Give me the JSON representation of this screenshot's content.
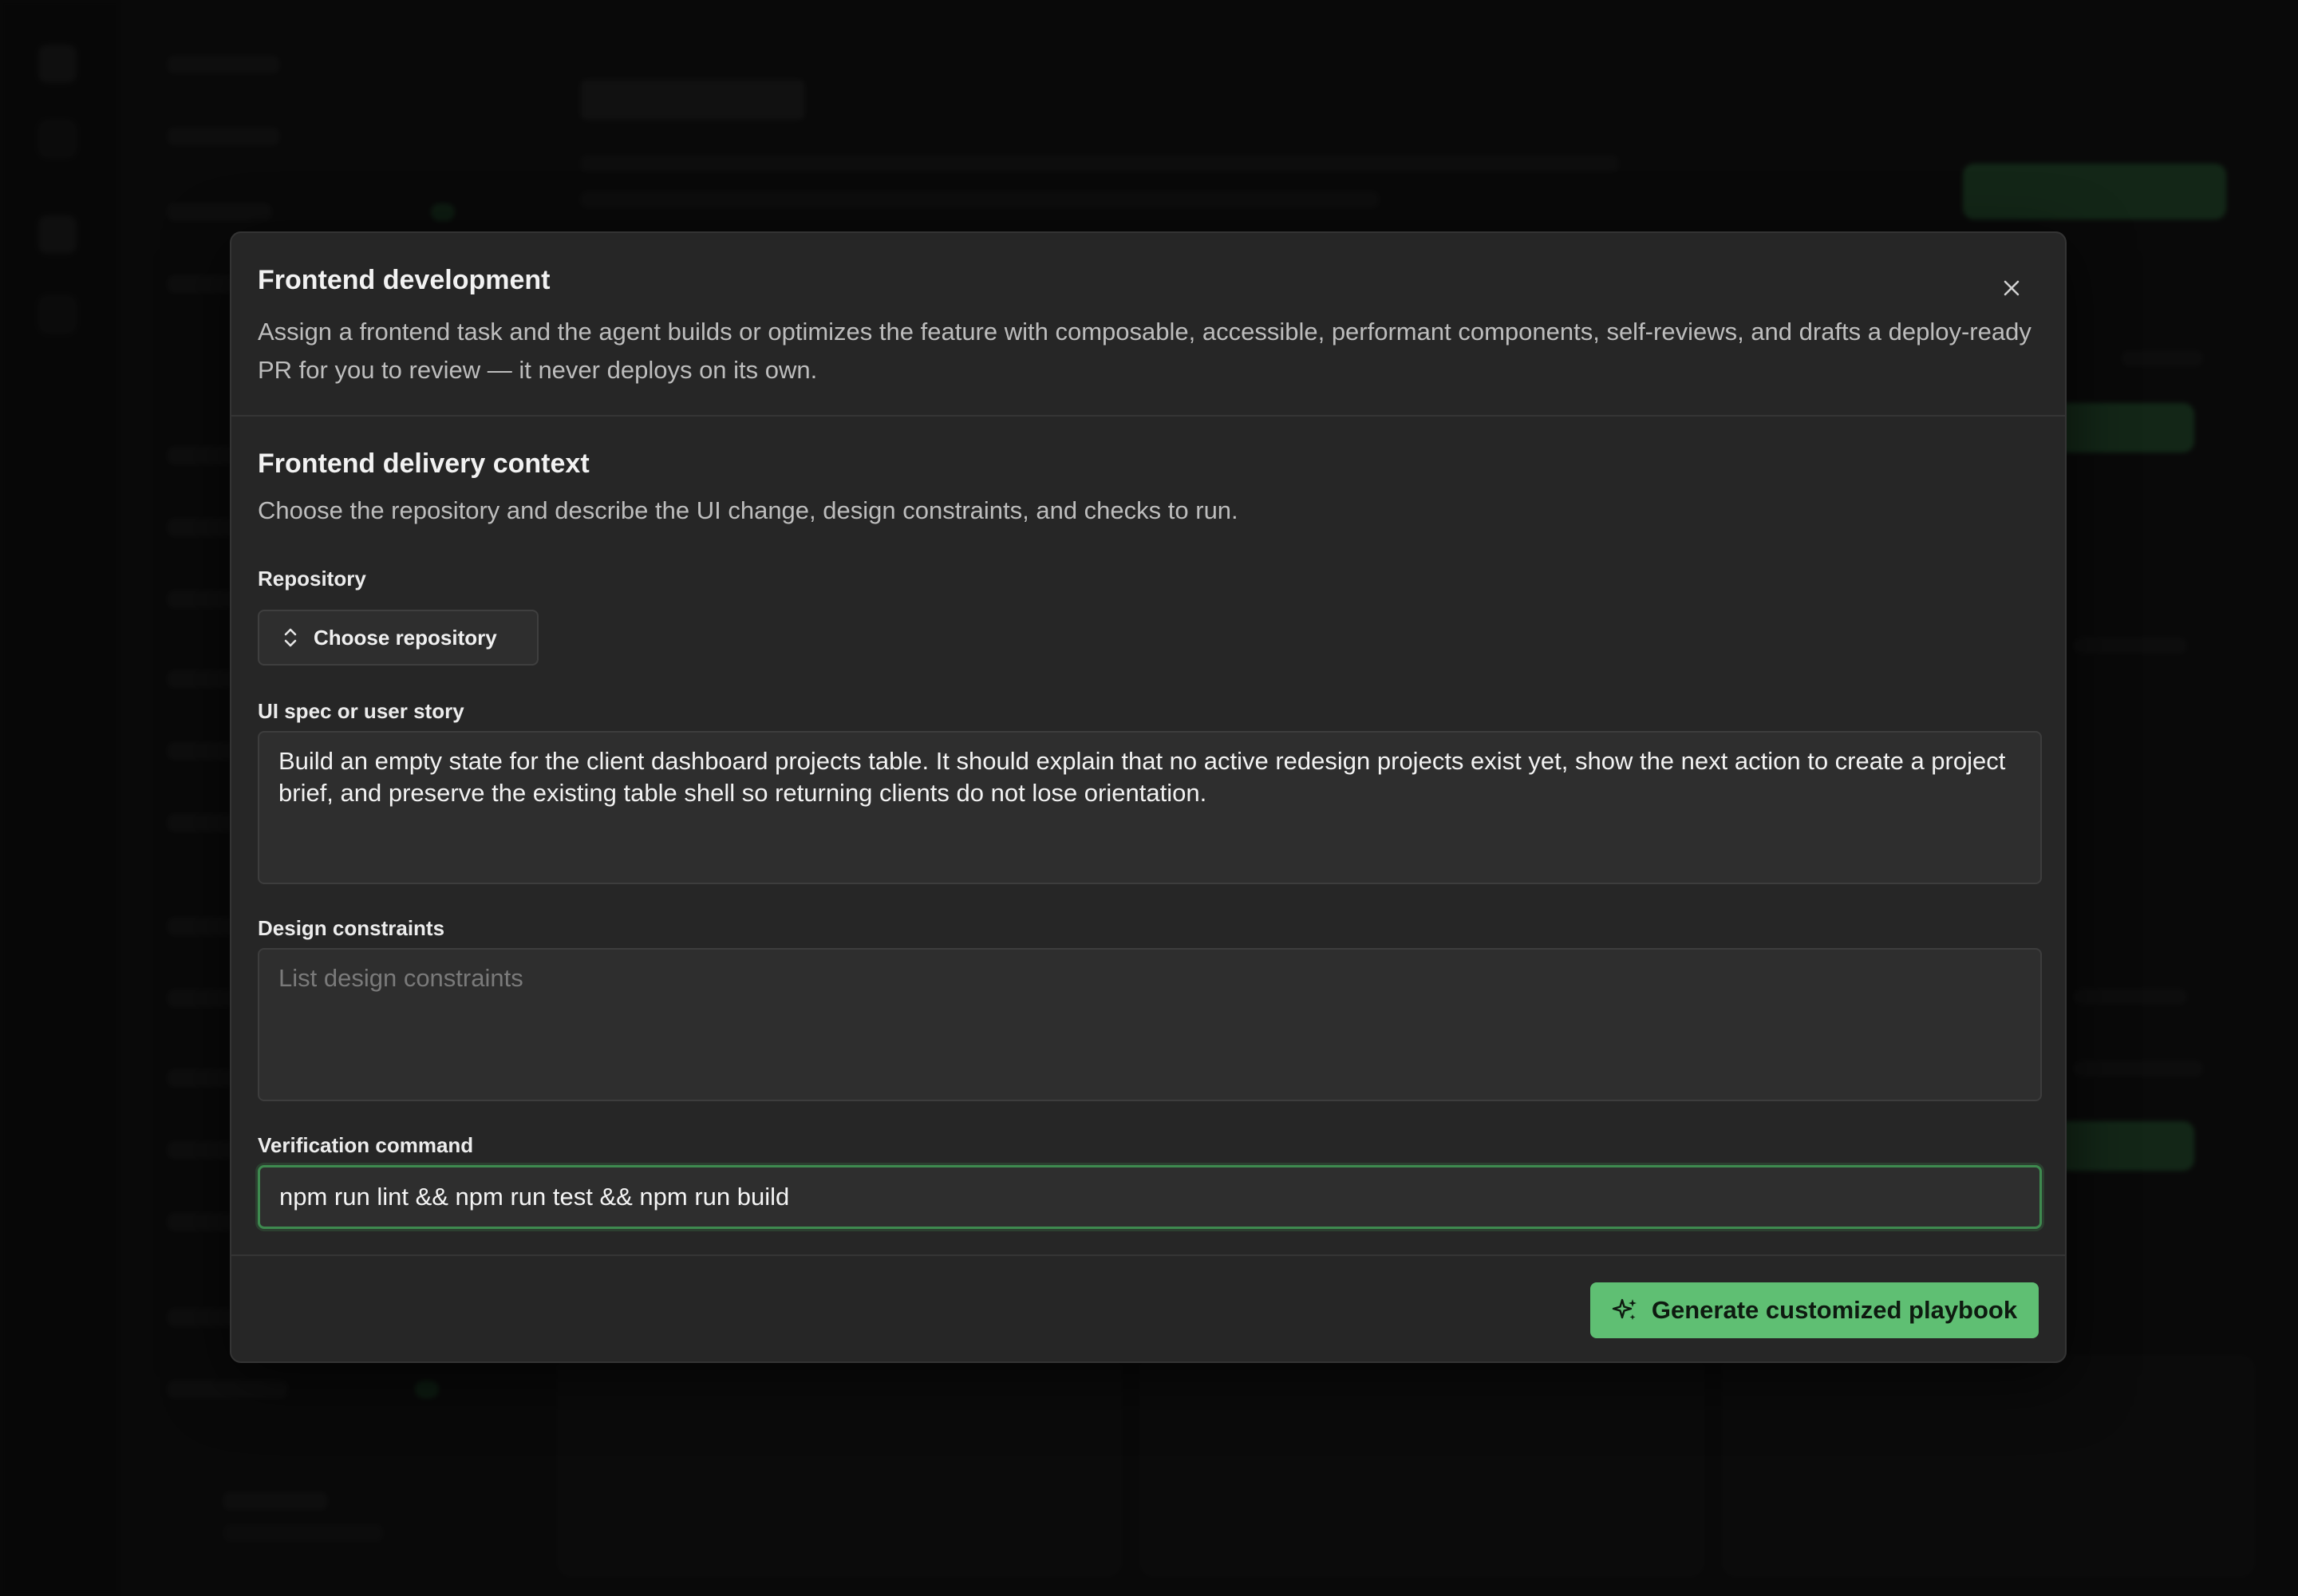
{
  "colors": {
    "accent": "#5fbf73",
    "focus_ring": "#3e8a4f",
    "modal_bg": "#262626",
    "overlay": "rgba(0,0,0,0.42)"
  },
  "modal": {
    "title": "Frontend development",
    "description": "Assign a frontend task and the agent builds or optimizes the feature with composable, accessible, performant components, self-reviews, and drafts a deploy-ready PR for you to review — it never deploys on its own.",
    "close_icon": "close-icon",
    "section": {
      "title": "Frontend delivery context",
      "description": "Choose the repository and describe the UI change, design constraints, and checks to run."
    },
    "repository": {
      "label": "Repository",
      "button_label": "Choose repository",
      "icon": "chevron-up-down-icon"
    },
    "ui_spec": {
      "label": "UI spec or user story",
      "value": "Build an empty state for the client dashboard projects table. It should explain that no active redesign projects exist yet, show the next action to create a project brief, and preserve the existing table shell so returning clients do not lose orientation."
    },
    "design_constraints": {
      "label": "Design constraints",
      "placeholder": "List design constraints",
      "value": ""
    },
    "verification": {
      "label": "Verification command",
      "value": "npm run lint && npm run test && npm run build"
    },
    "generate_button": {
      "label": "Generate customized playbook",
      "icon": "sparkles-icon"
    }
  }
}
